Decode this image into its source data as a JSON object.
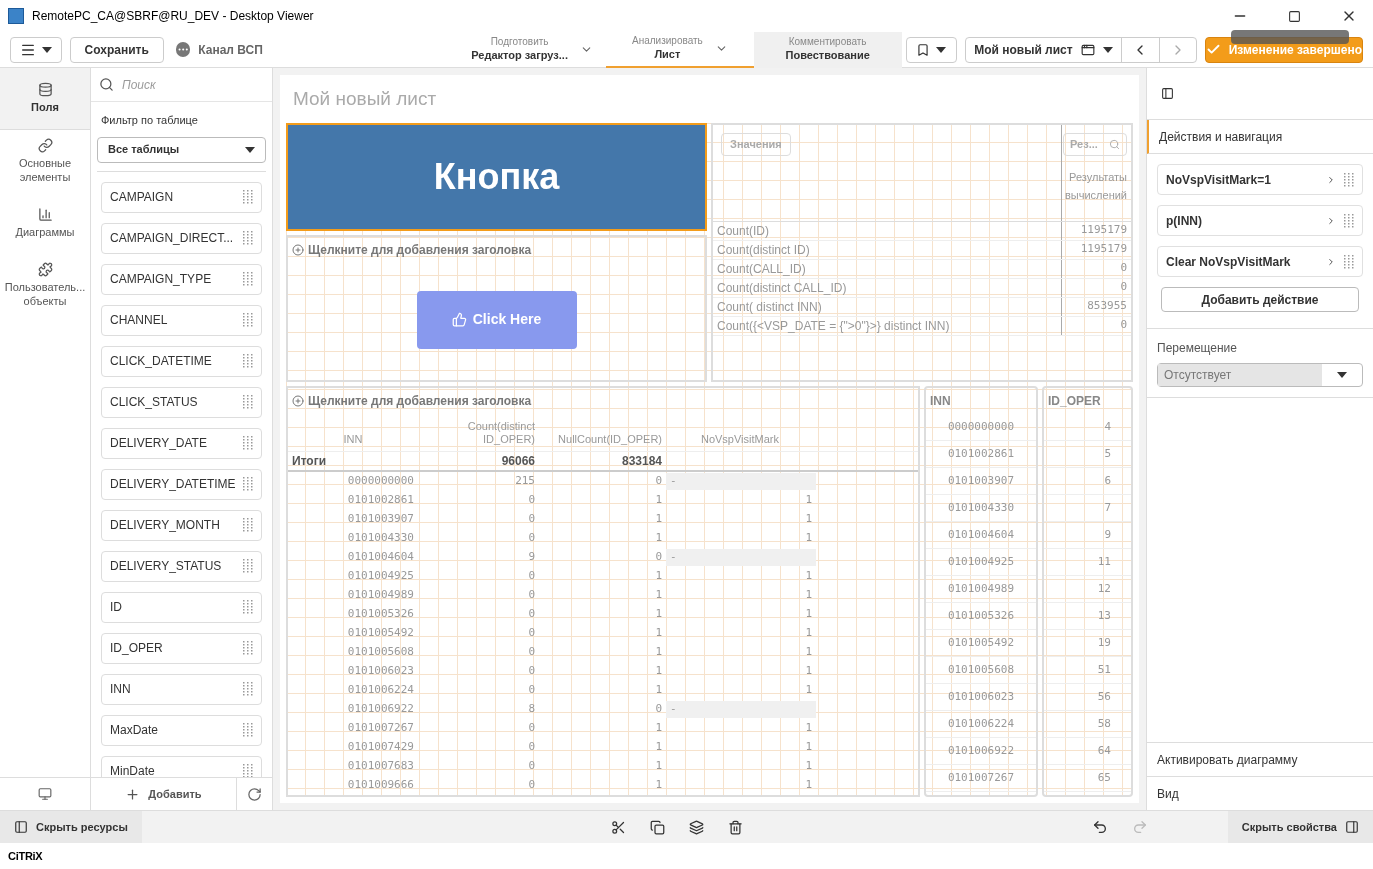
{
  "window": {
    "title": "RemotePC_CA@SBRF@RU_DEV - Desktop Viewer"
  },
  "toolbar": {
    "save": "Сохранить",
    "app_name": "Канал ВСП",
    "modes": [
      {
        "caption": "Подготовить",
        "label": "Редактор загруз...",
        "selected": false
      },
      {
        "caption": "Анализировать",
        "label": "Лист",
        "selected": true
      },
      {
        "caption": "Комментировать",
        "label": "Повествование",
        "selected": false
      }
    ],
    "sheet_selector": "Мой новый лист",
    "done": "Изменение завершено"
  },
  "nav": [
    {
      "label": "Поля",
      "selected": true
    },
    {
      "label": "Основные элементы",
      "selected": false
    },
    {
      "label": "Диаграммы",
      "selected": false
    },
    {
      "label": "Пользователь... объекты",
      "selected": false
    }
  ],
  "fields": {
    "search_placeholder": "Поиск",
    "filter_label": "Фильтр по таблице",
    "filter_value": "Все таблицы",
    "items": [
      "CAMPAIGN",
      "CAMPAIGN_DIRECT...",
      "CAMPAIGN_TYPE",
      "CHANNEL",
      "CLICK_DATETIME",
      "CLICK_STATUS",
      "DELIVERY_DATE",
      "DELIVERY_DATETIME",
      "DELIVERY_MONTH",
      "DELIVERY_STATUS",
      "ID",
      "ID_OPER",
      "INN",
      "MaxDate",
      "MinDate"
    ],
    "add": "Добавить"
  },
  "sheet": {
    "title": "Мой новый лист",
    "button_label": "Кнопка",
    "add_title": "Щелкните для добавления заголовка",
    "click_here": "Click Here",
    "kpi": {
      "values_tab": "Значения",
      "results_search": "Рез...",
      "results_header": "Результаты вычислений",
      "rows": [
        [
          "Count(ID)",
          "1195179"
        ],
        [
          "Count(distinct ID)",
          "1195179"
        ],
        [
          "Count(CALL_ID)",
          "0"
        ],
        [
          "Count(distinct CALL_ID)",
          "0"
        ],
        [
          "Count( distinct INN)",
          "853955"
        ],
        [
          "Count({<VSP_DATE = {\">0\"}>} distinct INN)",
          "0"
        ]
      ]
    },
    "table": {
      "title": "Щелкните для добавления заголовка",
      "columns": [
        "INN",
        "Count(distinct ID_OPER)",
        "NullCount(ID_OPER)",
        "NoVspVisitMark"
      ],
      "totals_label": "Итоги",
      "totals": [
        "96066",
        "833184"
      ],
      "rows": [
        [
          "0000000000",
          "215",
          "0",
          "-"
        ],
        [
          "0101002861",
          "0",
          "1",
          "1"
        ],
        [
          "0101003907",
          "0",
          "1",
          "1"
        ],
        [
          "0101004330",
          "0",
          "1",
          "1"
        ],
        [
          "0101004604",
          "9",
          "0",
          "-"
        ],
        [
          "0101004925",
          "0",
          "1",
          "1"
        ],
        [
          "0101004989",
          "0",
          "1",
          "1"
        ],
        [
          "0101005326",
          "0",
          "1",
          "1"
        ],
        [
          "0101005492",
          "0",
          "1",
          "1"
        ],
        [
          "0101005608",
          "0",
          "1",
          "1"
        ],
        [
          "0101006023",
          "0",
          "1",
          "1"
        ],
        [
          "0101006224",
          "0",
          "1",
          "1"
        ],
        [
          "0101006922",
          "8",
          "0",
          "-"
        ],
        [
          "0101007267",
          "0",
          "1",
          "1"
        ],
        [
          "0101007429",
          "0",
          "1",
          "1"
        ],
        [
          "0101007683",
          "0",
          "1",
          "1"
        ],
        [
          "0101009666",
          "0",
          "1",
          "1"
        ]
      ]
    },
    "lists": [
      {
        "title": "INN",
        "values": [
          "0000000000",
          "0101002861",
          "0101003907",
          "0101004330",
          "0101004604",
          "0101004925",
          "0101004989",
          "0101005326",
          "0101005492",
          "0101005608",
          "0101006023",
          "0101006224",
          "0101006922",
          "0101007267"
        ]
      },
      {
        "title": "ID_OPER",
        "values": [
          "4",
          "5",
          "6",
          "7",
          "9",
          "11",
          "12",
          "13",
          "19",
          "51",
          "56",
          "58",
          "64",
          "65"
        ]
      }
    ]
  },
  "properties": {
    "section": "Действия и навигация",
    "actions": [
      "NoVspVisitMark=1",
      "p(INN)",
      "Clear NoVspVisitMark"
    ],
    "add_action": "Добавить действие",
    "navigation_label": "Перемещение",
    "navigation_value": "Отсутствует",
    "activate": "Активировать диаграмму",
    "view": "Вид"
  },
  "bottom": {
    "hide_assets": "Скрыть ресурсы",
    "hide_properties": "Скрыть свойства"
  },
  "citrix": "CiTRiX"
}
